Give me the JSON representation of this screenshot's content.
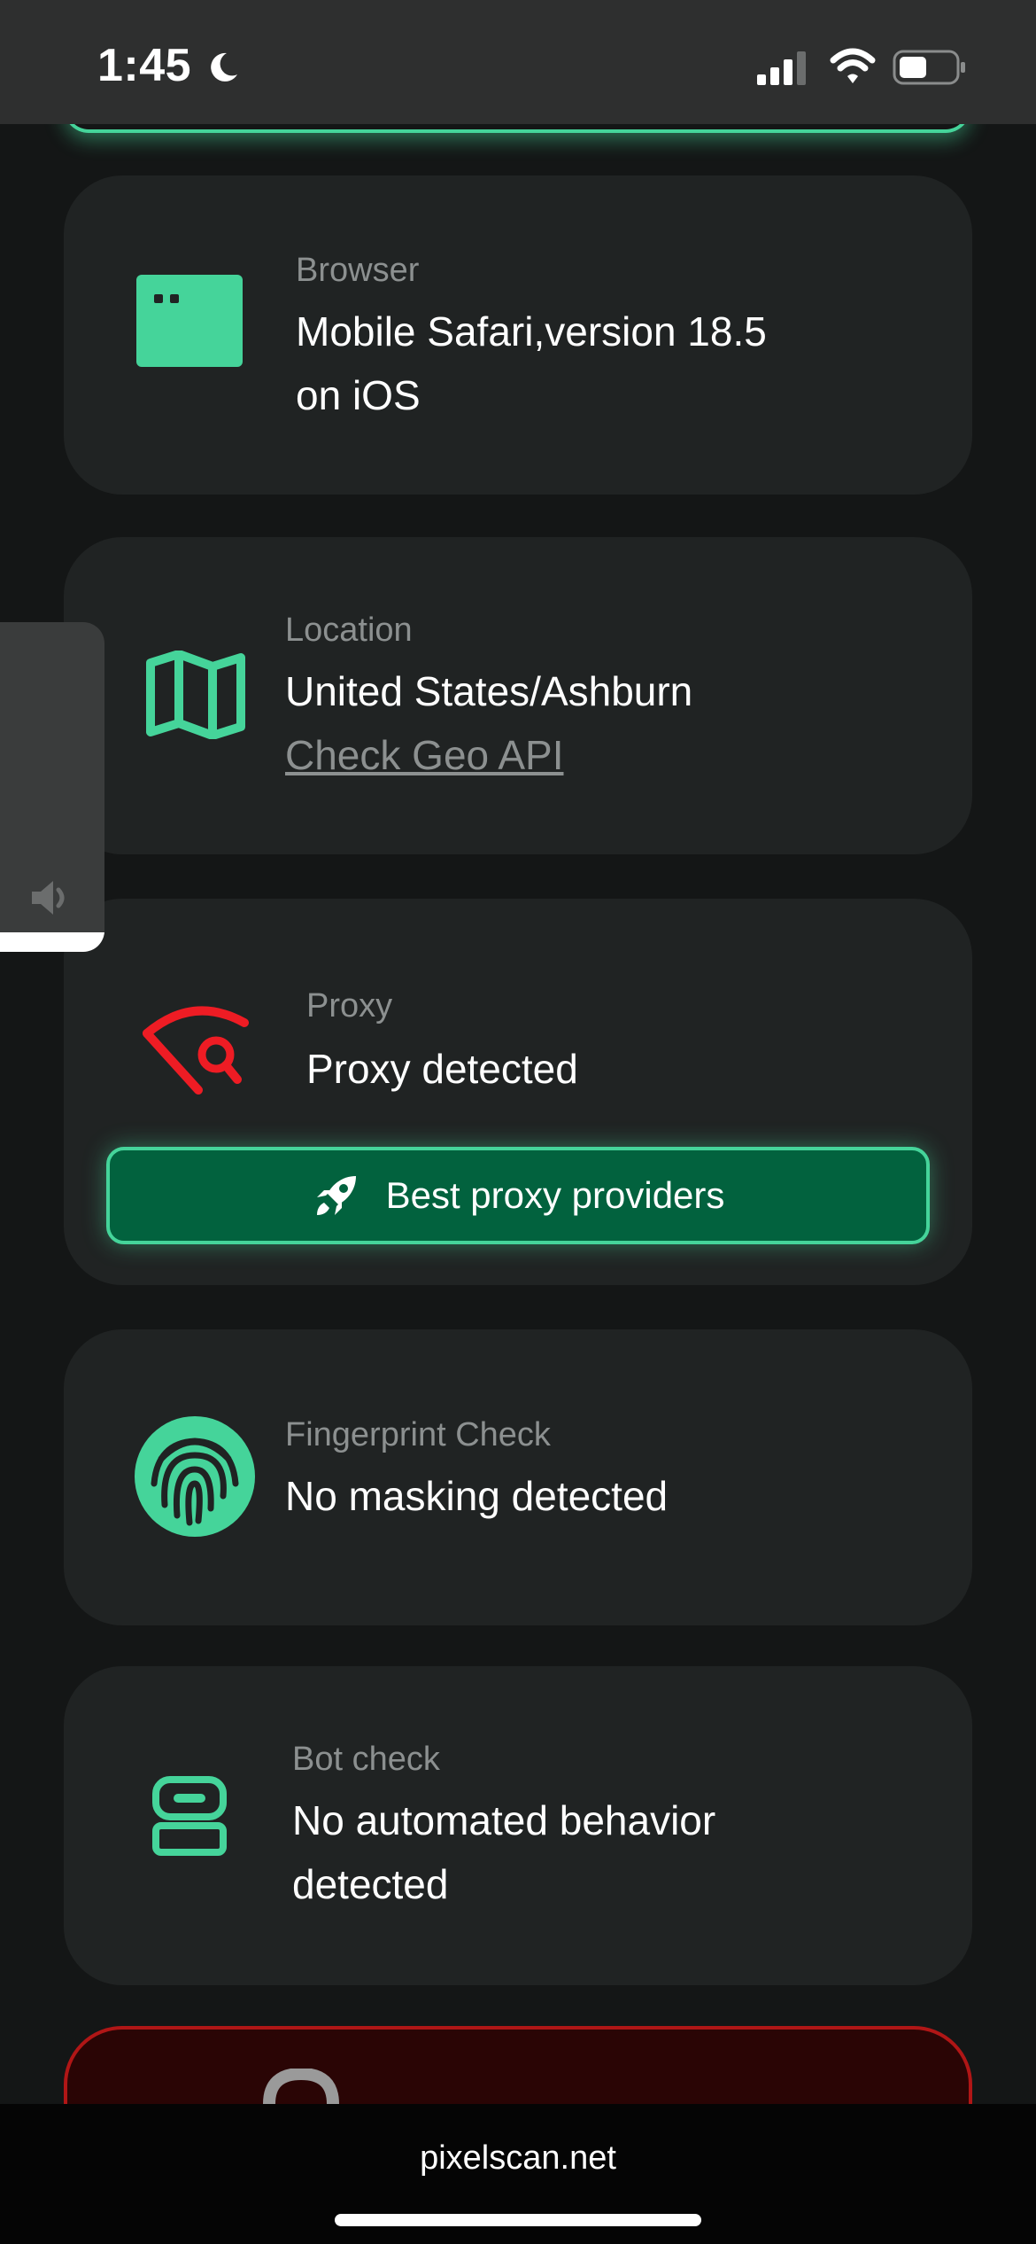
{
  "status_bar": {
    "time": "1:45"
  },
  "cards": {
    "browser": {
      "label": "Browser",
      "value_line1": "Mobile Safari,version 18.5",
      "value_line2": "on iOS"
    },
    "location": {
      "label": "Location",
      "value": "United States/Ashburn",
      "link": "Check Geo API"
    },
    "proxy": {
      "label": "Proxy",
      "value": "Proxy detected",
      "button_label": "Best proxy providers"
    },
    "fingerprint": {
      "label": "Fingerprint Check",
      "value": "No masking detected"
    },
    "bot": {
      "label": "Bot check",
      "value_line1": "No automated behavior",
      "value_line2": "detected"
    }
  },
  "browser_bar": {
    "url": "pixelscan.net"
  },
  "colors": {
    "accent_green": "#45d49a",
    "button_green": "#02623e",
    "alert_red": "#ee1c24",
    "card_bg": "#202323",
    "page_bg": "#141616"
  },
  "icons": [
    "moon-icon",
    "signal-icon",
    "wifi-icon",
    "battery-icon",
    "browser-window-icon",
    "map-icon",
    "eye-slash-search-icon",
    "rocket-icon",
    "fingerprint-icon",
    "robot-icon",
    "lock-icon",
    "speaker-icon"
  ]
}
